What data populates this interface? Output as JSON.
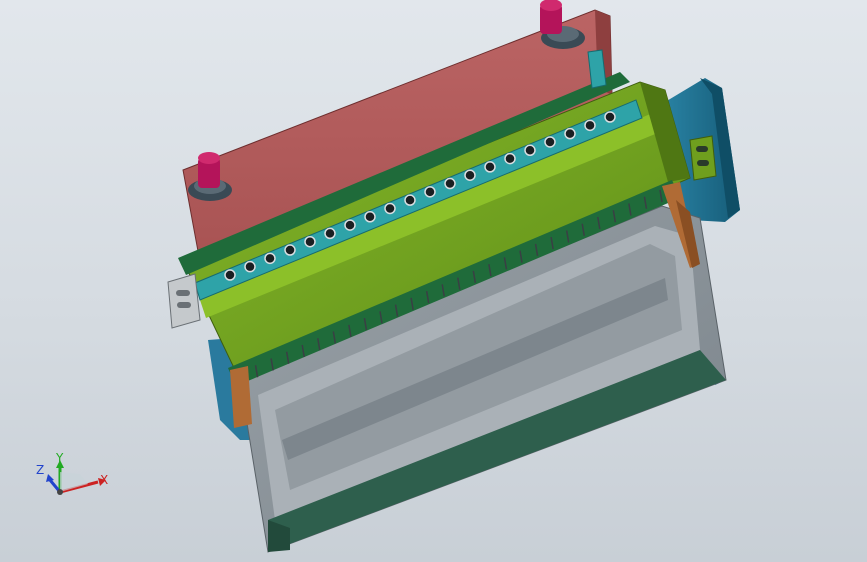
{
  "viewport": {
    "background_top": "#e2e7ec",
    "background_bottom": "#c8cfd6"
  },
  "colors": {
    "top_plate": "#b45c5c",
    "top_plate_dark": "#8e3f3f",
    "green_block": "#6f9f1e",
    "green_block_light": "#8cc029",
    "dark_green_strip": "#1f6b3a",
    "teal_strip": "#2ea3a8",
    "blue_block": "#1f7394",
    "grey_body": "#8a9299",
    "grey_light": "#aab1b7",
    "dark_green_bottom": "#2e5f4d",
    "magenta_post": "#b4145a",
    "copper": "#b06b35"
  },
  "model": {
    "parts": [
      "top-plate",
      "guide-post",
      "guide-post",
      "green-block",
      "dark-green-strip",
      "teal-strip",
      "blue-block",
      "grey-body",
      "bracket",
      "copper-clamp"
    ]
  },
  "triad": {
    "x_label": "X",
    "y_label": "Y",
    "z_label": "Z",
    "x_color": "#cc2222",
    "y_color": "#22aa22",
    "z_color": "#2244cc"
  }
}
